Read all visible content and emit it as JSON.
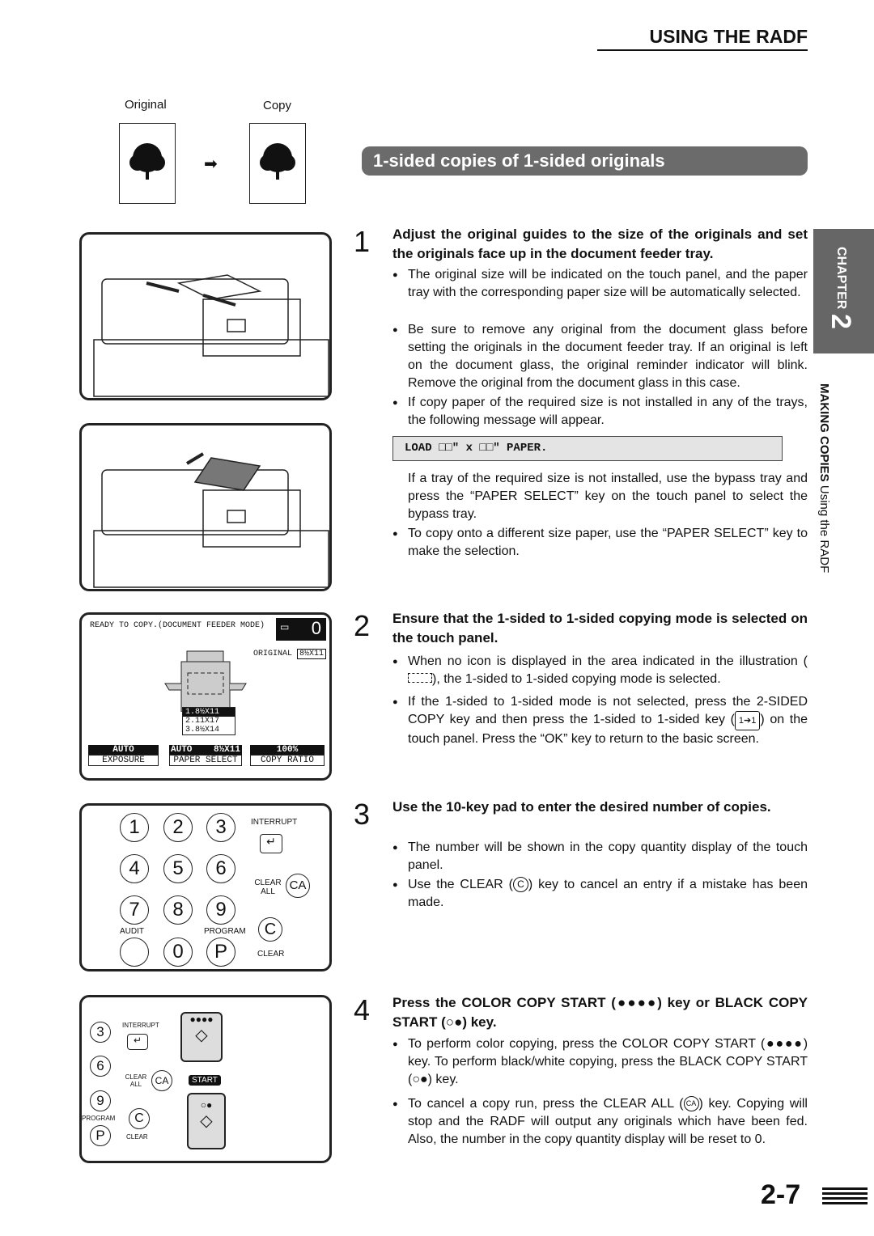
{
  "header": {
    "section": "USING THE RADF"
  },
  "illustration": {
    "original_label": "Original",
    "copy_label": "Copy"
  },
  "title": "1-sided copies of 1-sided originals",
  "side_tab": {
    "chapter": "CHAPTER",
    "chapter_num": "2",
    "section_bold": "MAKING COPIES",
    "section": "Using the RADF"
  },
  "touch_panel": {
    "status": "READY TO COPY.(DOCUMENT FEEDER MODE)",
    "count": "0",
    "original_label": "ORIGINAL",
    "original_size": "8½X11",
    "trays": [
      "1.8½X11",
      "2.11X17",
      "3.8½X14"
    ],
    "exposure_value": "AUTO",
    "exposure_label": "EXPOSURE",
    "paper_auto": "AUTO",
    "paper_size": "8½X11",
    "paper_label": "PAPER SELECT",
    "ratio_value": "100%",
    "ratio_label": "COPY RATIO"
  },
  "keypad": {
    "keys": [
      "1",
      "2",
      "3",
      "4",
      "5",
      "6",
      "7",
      "8",
      "9",
      "0",
      "P"
    ],
    "interrupt": "INTERRUPT",
    "clear_all": "CLEAR ALL",
    "ca": "CA",
    "audit": "AUDIT",
    "program": "PROGRAM",
    "c": "C",
    "clear": "CLEAR"
  },
  "start_panel": {
    "keys": [
      "3",
      "6",
      "9",
      "P"
    ],
    "interrupt": "INTERRUPT",
    "clear_all": "CLEAR ALL",
    "ca": "CA",
    "program": "PROGRAM",
    "c": "C",
    "clear": "CLEAR",
    "start": "START"
  },
  "steps": [
    {
      "num": "1",
      "heading": "Adjust the original guides to the size of the originals and set the originals face up in the document feeder tray.",
      "bullets": [
        "The original size will be indicated on the touch panel, and the paper tray with the corresponding paper size will be automatically selected.",
        "Be sure to remove any original from the document glass before setting the originals in the document feeder tray. If an original is left on the document glass, the original reminder indicator will blink. Remove the original from the document glass in this case.",
        "If copy paper of the required size is not installed in any of the trays, the following message will appear."
      ],
      "message": "LOAD □□\" x □□\" PAPER.",
      "note": "If a tray of the required size is not installed, use the bypass tray and press the “PAPER SELECT” key on the touch panel to select the bypass tray.",
      "bullet4": "To copy onto a different size paper, use the “PAPER SELECT” key to make the selection."
    },
    {
      "num": "2",
      "heading": "Ensure that the 1-sided to 1-sided copying mode is selected on the touch panel.",
      "b1a": "When no icon is displayed in the area indicated in the illustration (",
      "b1b": "), the 1-sided to 1-sided copying mode is selected.",
      "b2a": "If the 1-sided to 1-sided mode is not selected, press the 2-SIDED COPY key and then press the 1-sided to 1-sided key (",
      "b2b": ") on the touch panel. Press the “OK” key to return to the basic screen."
    },
    {
      "num": "3",
      "heading": "Use the 10-key pad to enter the desired number of copies.",
      "b1": "The number will be shown in the copy quantity display of the touch panel.",
      "b2a": "Use the CLEAR (",
      "b2icon": "C",
      "b2b": ") key to cancel an entry if a mistake has been made."
    },
    {
      "num": "4",
      "h1": "Press the COLOR COPY START (",
      "h2": ") key or BLACK COPY START (",
      "h3": ") key.",
      "b1a": "To perform color copying, press the COLOR COPY START (",
      "b1b": ") key. To perform black/white copying, press the BLACK COPY START (",
      "b1c": ") key.",
      "b2a": "To cancel a copy run, press the CLEAR ALL (",
      "b2icon": "CA",
      "b2b": ") key. Copying will stop and the RADF will output any originals which have been fed. Also, the number in the copy quantity display will be reset to 0."
    }
  ],
  "page_number": "2-7"
}
